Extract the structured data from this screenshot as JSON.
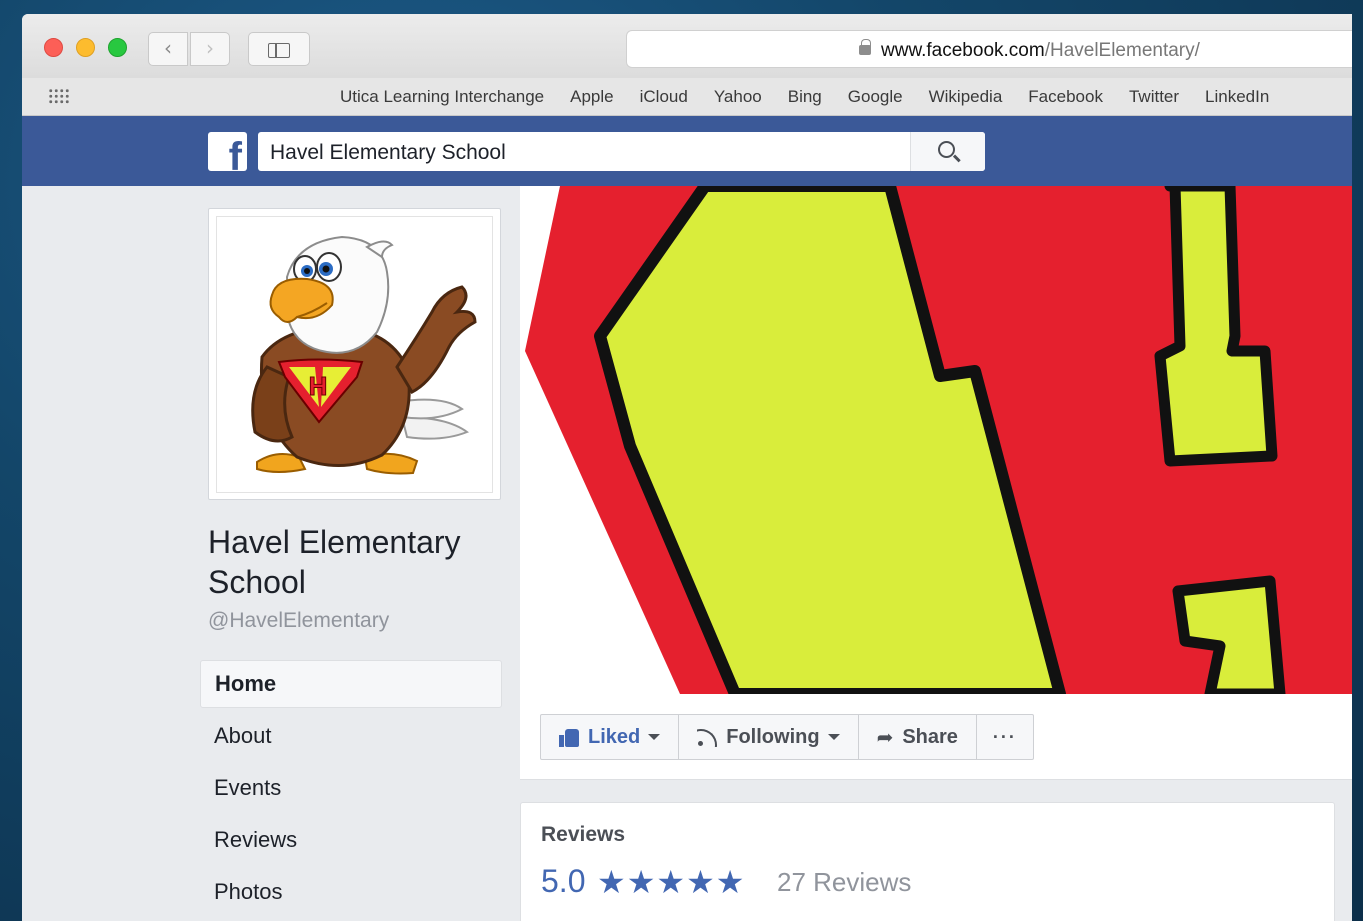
{
  "browser": {
    "url_domain": "www.facebook.com",
    "url_path": "/HavelElementary/",
    "favorites": [
      "Utica Learning Interchange",
      "Apple",
      "iCloud",
      "Yahoo",
      "Bing",
      "Google",
      "Wikipedia",
      "Facebook",
      "Twitter",
      "LinkedIn"
    ]
  },
  "fb_header": {
    "logo_letter": "f",
    "search_value": "Havel Elementary School"
  },
  "page": {
    "name": "Havel Elementary School",
    "handle": "@HavelElementary",
    "logo_letter": "H"
  },
  "side_nav": [
    "Home",
    "About",
    "Events",
    "Reviews",
    "Photos"
  ],
  "actions": {
    "liked": "Liked",
    "following": "Following",
    "share": "Share",
    "more": "···"
  },
  "reviews": {
    "title": "Reviews",
    "rating": "5.0",
    "stars": 5,
    "stars_text": "★★★★★",
    "count_text": "27 Reviews"
  },
  "colors": {
    "fb_blue": "#3b5998",
    "link_blue": "#4267b2",
    "cover_red": "#e5202e",
    "cover_yellow": "#d9ed3b"
  }
}
